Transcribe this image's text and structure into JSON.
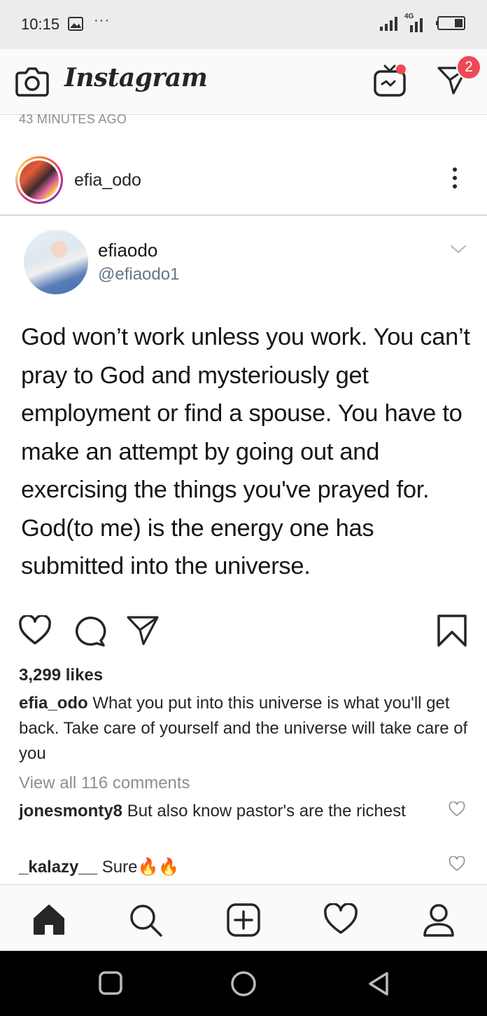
{
  "status_bar": {
    "time": "10:15",
    "more": "···",
    "network": "4G"
  },
  "app": {
    "name": "Instagram",
    "dm_badge_count": "2"
  },
  "post": {
    "time_ago": "43 MINUTES AGO",
    "username": "efia_odo",
    "tweet": {
      "display_name": "efiaodo",
      "handle": "@efiaodo1",
      "text": "God won’t work unless you work. You can’t pray to God and mysteriously get employment or find a spouse. You have to make an attempt by going out and exercising the things you've prayed for. God(to me) is the energy one has submitted into the universe."
    },
    "likes": "3,299 likes",
    "caption": {
      "user": "efia_odo",
      "text": "What you put into this universe is what you'll get back. Take care of yourself and the universe will take care of you"
    },
    "view_all_comments": "View all 116 comments",
    "comments": [
      {
        "user": "jonesmonty8",
        "text": "But also know pastor's are the richest"
      },
      {
        "user": "_kalazy__",
        "text": "Sure🔥🔥"
      }
    ]
  },
  "icons": {
    "camera": "camera-icon",
    "igtv": "igtv-icon",
    "direct": "direct-message-icon",
    "more": "more-options-icon",
    "like": "heart-icon",
    "comment": "comment-icon",
    "share": "share-icon",
    "save": "bookmark-icon",
    "home": "home-icon",
    "search": "search-icon",
    "new_post": "new-post-icon",
    "activity": "activity-heart-icon",
    "profile": "profile-icon"
  },
  "colors": {
    "badge": "#ed4956",
    "text": "#262626",
    "muted": "#8e8e8e",
    "twitter_text": "#14171a",
    "twitter_muted": "#657786"
  }
}
